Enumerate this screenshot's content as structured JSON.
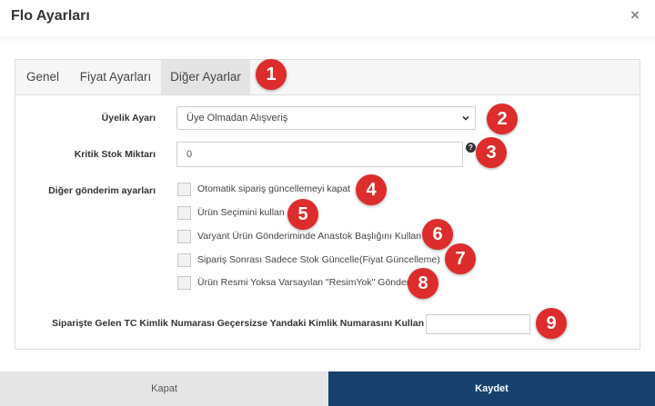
{
  "modal": {
    "title": "Flo Ayarları",
    "close_symbol": "×"
  },
  "tabs": [
    {
      "label": "Genel",
      "active": false
    },
    {
      "label": "Fiyat Ayarları",
      "active": false
    },
    {
      "label": "Diğer Ayarlar",
      "active": true
    }
  ],
  "form": {
    "membership": {
      "label": "Üyelik Ayarı",
      "selected": "Üye Olmadan Alışveriş"
    },
    "critical_stock": {
      "label": "Kritik Stok Miktarı",
      "value": "0",
      "help_icon": "question-circle-icon"
    },
    "other_sending": {
      "label": "Diğer gönderim ayarları",
      "options": [
        {
          "label": "Otomatik sipariş güncellemeyi kapat",
          "checked": false
        },
        {
          "label": "Ürün Seçimini kullan",
          "checked": false
        },
        {
          "label": "Varyant Ürün Gönderiminde Anastok Başlığını Kullan",
          "checked": false
        },
        {
          "label": "Sipariş Sonrası Sadece Stok Güncelle(Fiyat Güncelleme)",
          "checked": false
        },
        {
          "label": "Ürün Resmi Yoksa Varsayılan \"ResimYok\" Gönder",
          "checked": false
        }
      ]
    },
    "tc_identity": {
      "label": "Siparişte Gelen TC Kimlik Numarası Geçersizse Yandaki Kimlik Numarasını Kullan",
      "value": ""
    }
  },
  "annotations": [
    "1",
    "2",
    "3",
    "4",
    "5",
    "6",
    "7",
    "8",
    "9"
  ],
  "footer": {
    "cancel_label": "Kapat",
    "save_label": "Kaydet"
  },
  "colors": {
    "badge": "#dd2c2c",
    "primary_button": "#17416c",
    "secondary_button": "#e5e5e5",
    "active_tab": "#e4e4e4"
  }
}
